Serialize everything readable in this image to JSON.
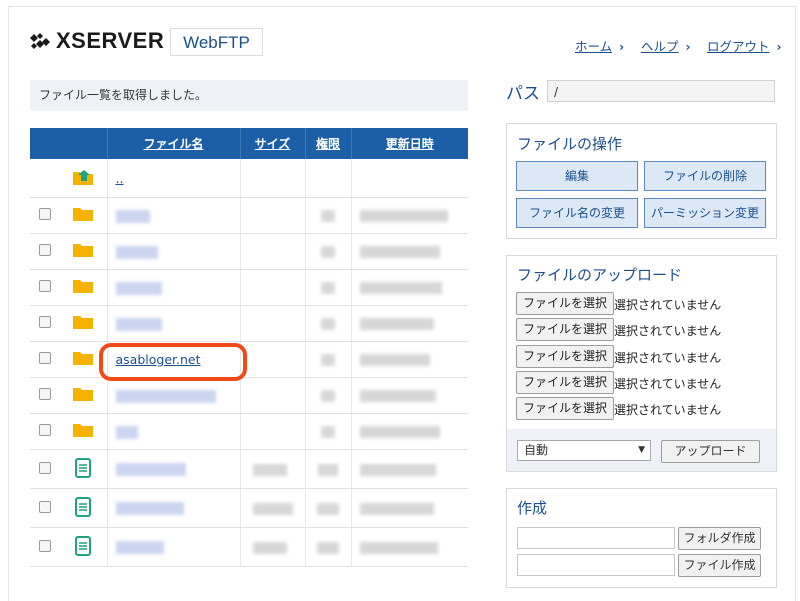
{
  "header": {
    "logo_text": "XSERVER",
    "product": "WebFTP",
    "nav": [
      {
        "label": "ホーム"
      },
      {
        "label": "ヘルプ"
      },
      {
        "label": "ログアウト"
      }
    ]
  },
  "status_message": "ファイル一覧を取得しました。",
  "table": {
    "columns": [
      "",
      "",
      "ファイル名",
      "サイズ",
      "権限",
      "更新日時"
    ],
    "parent_link": "..",
    "highlighted_file": "asabloger.net"
  },
  "path": {
    "label": "パス",
    "value": "/"
  },
  "operations": {
    "title": "ファイルの操作",
    "buttons": [
      "編集",
      "ファイルの削除",
      "ファイル名の変更",
      "パーミッション変更"
    ]
  },
  "upload": {
    "title": "ファイルのアップロード",
    "choose_label": "ファイルを選択",
    "no_file_label": "選択されていません",
    "mode_value": "自動",
    "upload_button": "アップロード"
  },
  "create": {
    "title": "作成",
    "folder_button": "フォルダ作成",
    "file_button": "ファイル作成"
  },
  "colors": {
    "header_bar": "#1d5fa6",
    "link": "#1c4f8c",
    "folder": "#f5b300",
    "document": "#1fa37a",
    "highlight": "#f04a18"
  }
}
